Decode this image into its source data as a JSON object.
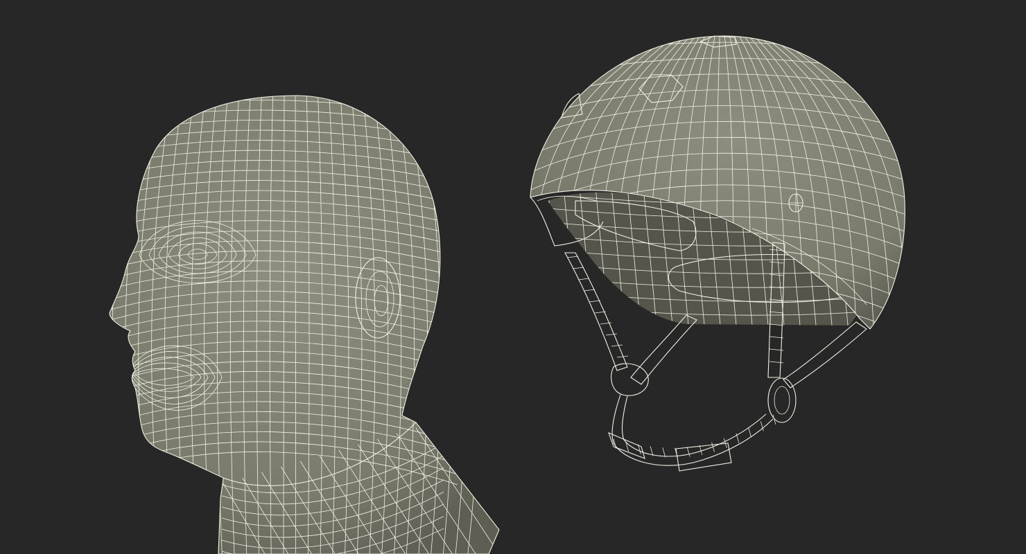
{
  "scene": {
    "background_color": "#272727",
    "mesh_fill_color": "#858576",
    "mesh_shadow_color": "#5a5a4f",
    "wire_color": "#f2f2e6"
  },
  "objects": [
    {
      "name": "head-wireframe",
      "icon": "head-mesh-icon"
    },
    {
      "name": "helmet-wireframe",
      "icon": "helmet-mesh-icon"
    }
  ]
}
